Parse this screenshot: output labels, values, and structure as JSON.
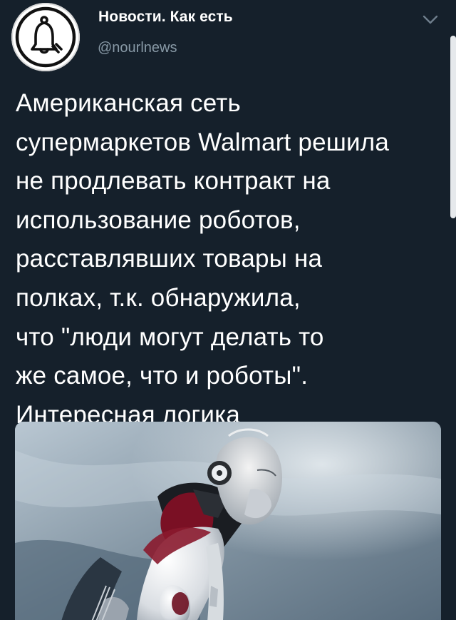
{
  "tweet": {
    "author": {
      "name": "Новости. Как есть",
      "handle": "@nourlnews",
      "avatar_icon": "bell-logo-icon"
    },
    "menu_icon": "chevron-down-icon",
    "text": "Американская сеть\nсупермаркетов Walmart решила\nне продлевать контракт на\nиспользование роботов,\nрасставлявших товары на\nполках, т.к. обнаружила,\nчто \"люди могут делать то\nже самое, что и роботы\".\nИнтересная логика",
    "media": {
      "type": "photo",
      "subject_icon": "robot-image"
    }
  },
  "colors": {
    "background": "#15202b",
    "text_primary": "#ffffff",
    "text_secondary": "#8899a6",
    "robot_accent": "#8a1a2e"
  }
}
